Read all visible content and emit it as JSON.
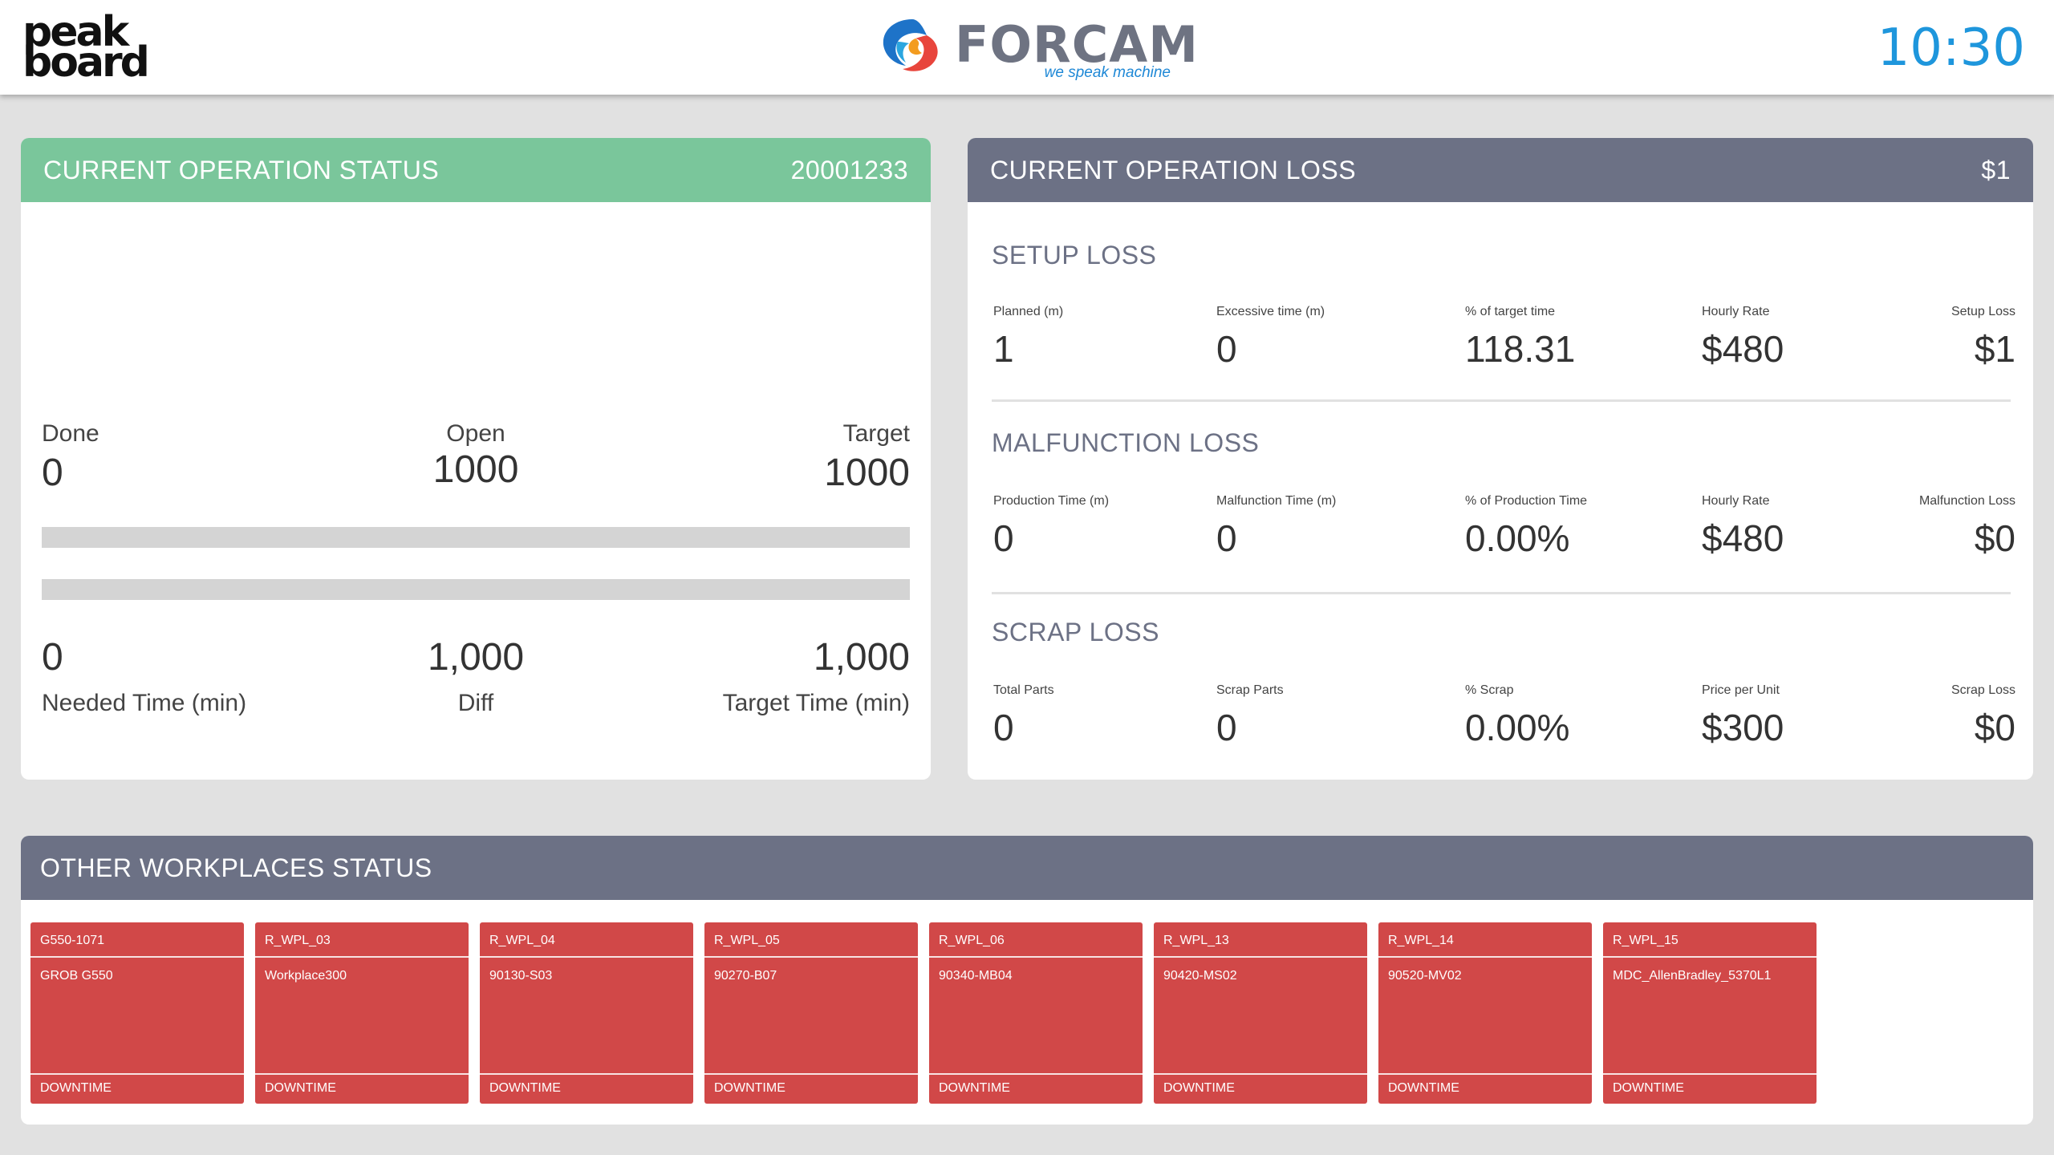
{
  "header": {
    "logo_left_line1": "peak",
    "logo_left_line2": "board",
    "logo_center_word": "FORCAM",
    "logo_center_tagline": "we speak machine",
    "clock": "10:30"
  },
  "status": {
    "title": "CURRENT OPERATION STATUS",
    "order_number": "20001233",
    "done_label": "Done",
    "done_value": "0",
    "open_label": "Open",
    "open_value": "1000",
    "target_label": "Target",
    "target_value": "1000",
    "quantity_progress": 0,
    "time_progress": 0,
    "needed_time_value": "0",
    "needed_time_label": "Needed Time (min)",
    "diff_value": "1,000",
    "diff_label": "Diff",
    "target_time_value": "1,000",
    "target_time_label": "Target Time (min)"
  },
  "loss": {
    "title": "CURRENT OPERATION LOSS",
    "total": "$1",
    "setup": {
      "title": "SETUP LOSS",
      "labels": [
        "Planned (m)",
        "Excessive time (m)",
        "% of target time",
        "Hourly Rate",
        "Setup Loss"
      ],
      "values": [
        "1",
        "0",
        "118.31",
        "$480",
        "$1"
      ]
    },
    "malfunction": {
      "title": "MALFUNCTION LOSS",
      "labels": [
        "Production Time (m)",
        "Malfunction Time (m)",
        "% of Production Time",
        "Hourly Rate",
        "Malfunction Loss"
      ],
      "values": [
        "0",
        "0",
        "0.00%",
        "$480",
        "$0"
      ]
    },
    "scrap": {
      "title": "SCRAP LOSS",
      "labels": [
        "Total Parts",
        "Scrap Parts",
        "% Scrap",
        "Price per Unit",
        "Scrap Loss"
      ],
      "values": [
        "0",
        "0",
        "0.00%",
        "$300",
        "$0"
      ]
    }
  },
  "workplaces": {
    "title": "OTHER WORKPLACES STATUS",
    "status_color": "#d14848",
    "items": [
      {
        "id": "G550-1071",
        "name": "GROB G550",
        "status": "DOWNTIME"
      },
      {
        "id": "R_WPL_03",
        "name": "Workplace300",
        "status": "DOWNTIME"
      },
      {
        "id": "R_WPL_04",
        "name": "90130-S03",
        "status": "DOWNTIME"
      },
      {
        "id": "R_WPL_05",
        "name": "90270-B07",
        "status": "DOWNTIME"
      },
      {
        "id": "R_WPL_06",
        "name": "90340-MB04",
        "status": "DOWNTIME"
      },
      {
        "id": "R_WPL_13",
        "name": "90420-MS02",
        "status": "DOWNTIME"
      },
      {
        "id": "R_WPL_14",
        "name": "90520-MV02",
        "status": "DOWNTIME"
      },
      {
        "id": "R_WPL_15",
        "name": "MDC_AllenBradley_5370L1",
        "status": "DOWNTIME"
      }
    ]
  },
  "colors": {
    "accent_green": "#7ac69b",
    "header_slate": "#6c7185",
    "clock_blue": "#1e96dc",
    "downtime_red": "#d14848"
  }
}
